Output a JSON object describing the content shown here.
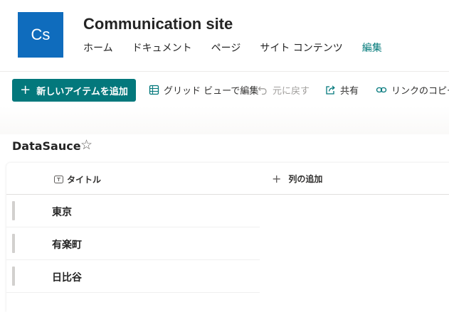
{
  "site": {
    "logo_text": "Cs",
    "title": "Communication site",
    "nav": [
      "ホーム",
      "ドキュメント",
      "ページ",
      "サイト コンテンツ",
      "編集"
    ]
  },
  "commands": {
    "new_item": "新しいアイテムを追加",
    "grid_edit": "グリッド ビューで編集",
    "undo": "元に戻す",
    "share": "共有",
    "copy_link": "リンクのコピー"
  },
  "list": {
    "title": "DataSauce",
    "columns": {
      "title": "タイトル",
      "add_column": "列の追加"
    },
    "rows": [
      "東京",
      "有楽町",
      "日比谷"
    ]
  },
  "colors": {
    "accent": "#03787c",
    "logo": "#0f6cbd"
  }
}
